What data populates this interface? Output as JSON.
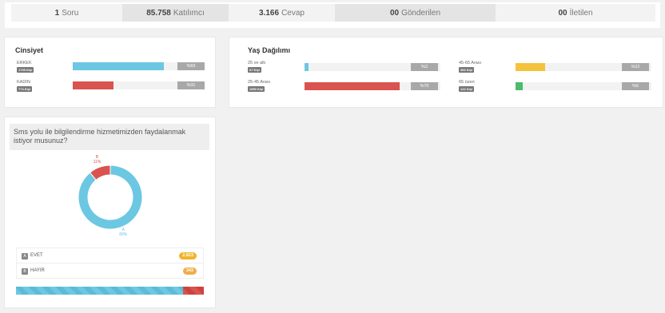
{
  "stats": [
    {
      "value": "1",
      "label": "Soru"
    },
    {
      "value": "85.758",
      "label": "Katılımcı"
    },
    {
      "value": "3.166",
      "label": "Cevap"
    },
    {
      "value": "00",
      "label": "Gönderilen"
    },
    {
      "value": "00",
      "label": "İletilen"
    }
  ],
  "gender": {
    "title": "Cinsiyet",
    "rows": [
      {
        "label": "ERKEK",
        "count": "1705 Kişi",
        "pct_label": "%69",
        "pct": 69,
        "color": "#6cc7e2"
      },
      {
        "label": "KADIN",
        "count": "774 Kişi",
        "pct_label": "%31",
        "pct": 31,
        "color": "#d9534f"
      }
    ]
  },
  "age": {
    "title": "Yaş Dağılımı",
    "rows": [
      {
        "label": "25 ve altı",
        "count": "67 Kişi",
        "pct_label": "%3",
        "pct": 3,
        "color": "#6cc7e2"
      },
      {
        "label": "25-45 Arası",
        "count": "1590 Kişi",
        "pct_label": "%70",
        "pct": 70,
        "color": "#d9534f"
      },
      {
        "label": "45-65 Arası",
        "count": "366 Kişi",
        "pct_label": "%22",
        "pct": 22,
        "color": "#f4c23b"
      },
      {
        "label": "65 üzeri",
        "count": "122 Kişi",
        "pct_label": "%5",
        "pct": 5,
        "color": "#4cbb6c"
      }
    ]
  },
  "poll": {
    "question": "Sms yolu ile bilgilendirme hizmetimizden faydalanmak istiyor musunuz?",
    "chart_data": {
      "type": "pie",
      "categories": [
        "EVET",
        "HAYIR"
      ],
      "values": [
        89,
        11
      ],
      "colors": [
        "#6cc7e2",
        "#d9534f"
      ],
      "data_labels": [
        {
          "letter": "A",
          "pct": "89%"
        },
        {
          "letter": "B",
          "pct": "11%"
        }
      ]
    },
    "options": [
      {
        "letter": "A",
        "label": "EVET",
        "count": "2.823",
        "count_color": "#f0b429"
      },
      {
        "letter": "B",
        "label": "HAYIR",
        "count": "343",
        "count_color": "#f0ad4e"
      }
    ]
  }
}
